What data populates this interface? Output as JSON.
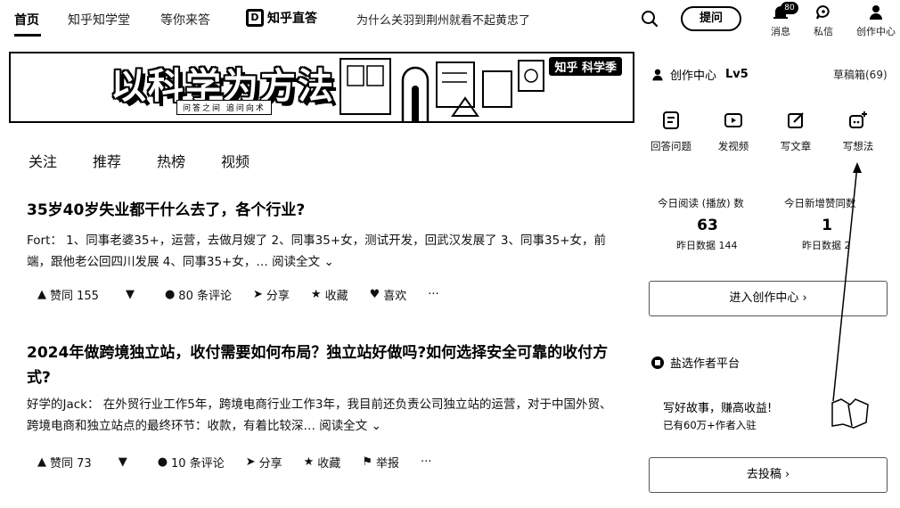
{
  "nav": {
    "home": "首页",
    "xuetang": "知乎知学堂",
    "waiting": "等你来答",
    "zhida": "知乎直答",
    "hot_question": "为什么关羽到荆州就看不起黄忠了",
    "ask_button": "提问",
    "messages": "消息",
    "messages_badge": "80",
    "private_msg": "私信",
    "creator_center": "创作中心"
  },
  "banner": {
    "title": "以科学为方法",
    "subtitle": "问答之间 追问向术",
    "tag": "知乎 科学季"
  },
  "feed_tabs": [
    "关注",
    "推荐",
    "热榜",
    "视频"
  ],
  "feed": [
    {
      "title": "35岁40岁失业都干什么去了，各个行业?",
      "excerpt": "Fort： 1、同事老婆35+，运营，去做月嫂了 2、同事35+女，测试开发，回武汉发展了 3、同事35+女，前端，跟他老公回四川发展 4、同事35+女，…",
      "read_more": "阅读全文",
      "upvote": "赞同 155",
      "comments": "80 条评论",
      "share": "分享",
      "favorite": "收藏",
      "like": "喜欢",
      "more": "···"
    },
    {
      "title": "2024年做跨境独立站，收付需要如何布局？独立站好做吗?如何选择安全可靠的收付方式?",
      "excerpt": "好学的Jack： 在外贸行业工作5年，跨境电商行业工作3年，我目前还负责公司独立站的运营，对于中国外贸、跨境电商和独立站点的最终环节：收款，有着比较深…",
      "read_more": "阅读全文",
      "upvote": "赞同 73",
      "comments": "10 条评论",
      "share": "分享",
      "favorite": "收藏",
      "report": "举报",
      "more": "···"
    }
  ],
  "sidebar": {
    "creator_label": "创作中心",
    "level": "Lv5",
    "drafts": "草稿箱(69)",
    "quick_actions": [
      "回答问题",
      "发视频",
      "写文章",
      "写想法"
    ],
    "stats": [
      {
        "label": "今日阅读 (播放) 数",
        "value": "63",
        "yesterday": "昨日数据 144"
      },
      {
        "label": "今日新增赞同数",
        "value": "1",
        "yesterday": "昨日数据 2"
      }
    ],
    "enter_creator": "进入创作中心 ›",
    "platform": "盐选作者平台",
    "promo_line1": "写好故事，赚高收益!",
    "promo_line2": "已有60万+作者入驻",
    "submit": "去投稿 ›"
  }
}
